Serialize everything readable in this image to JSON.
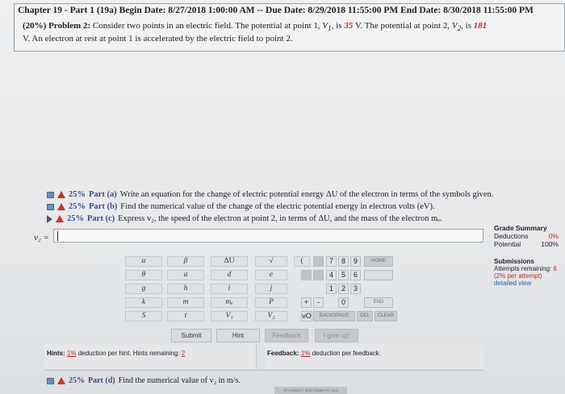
{
  "header": {
    "line": "Chapter 19 - Part 1 (19a) Begin Date: 8/27/2018 1:00:00 AM -- Due Date: 8/29/2018 11:55:00 PM End Date: 8/30/2018 11:55:00 PM"
  },
  "problem": {
    "prefix": "(20%) Problem 2:",
    "text_a": " Consider two points in an electric field. The potential at point 1, ",
    "v1_sym": "V",
    "v1_sub": "1",
    "text_b": ", is ",
    "v1_val": "35",
    "text_c": " V. The potential at point 2, ",
    "v2_sym": "V",
    "v2_sub": "2",
    "text_d": ", is ",
    "v2_val": "181",
    "line2": "V. An electron at rest at point 1 is accelerated by the electric field to point 2."
  },
  "parts": [
    {
      "pct": "25%",
      "label": "Part (a)",
      "text": "Write an equation for the change of electric potential energy ΔU of the electron in terms of the symbols given."
    },
    {
      "pct": "25%",
      "label": "Part (b)",
      "text": "Find the numerical value of the change of the electric potential energy in electron volts (eV)."
    },
    {
      "pct": "25%",
      "label": "Part (c)",
      "text": "Express v₂, the speed of the electron at point 2, in terms of ΔU, and the mass of the electron mₑ."
    },
    {
      "pct": "25%",
      "label": "Part (d)",
      "text": "Find the numerical value of v₂ in m/s."
    }
  ],
  "answer": {
    "label": "v₂ =",
    "value": ""
  },
  "grade_summary": {
    "title": "Grade Summary",
    "deductions_label": "Deductions",
    "deductions_val": "0%",
    "potential_label": "Potential",
    "potential_val": "100%"
  },
  "submissions": {
    "title": "Submissions",
    "attempts": "Attempts remaining: ",
    "attempts_val": "6",
    "per_attempt": "(2% per attempt)",
    "detailed": "detailed view"
  },
  "keypad": {
    "symbols": [
      [
        "α",
        "β",
        "ΔU",
        "√",
        "("
      ],
      [
        "θ",
        "a",
        "d",
        "e",
        ""
      ],
      [
        "g",
        "h",
        "i",
        "j",
        ""
      ],
      [
        "k",
        "m",
        "mₑ",
        "P",
        ""
      ],
      [
        "S",
        "t",
        "V₁",
        "V₂",
        ""
      ]
    ],
    "numbers": [
      [
        "7",
        "8",
        "9"
      ],
      [
        "4",
        "5",
        "6"
      ],
      [
        "1",
        "2",
        "3"
      ],
      [
        "+",
        "-",
        "0"
      ],
      [
        "vO",
        "",
        ""
      ]
    ],
    "home": "HOME",
    "end": "END",
    "backspace": "BACKSPACE",
    "del": "DEL",
    "clear": "CLEAR"
  },
  "buttons": {
    "submit": "Submit",
    "hint": "Hint",
    "feedback": "Feedback",
    "give_up": "I give up!"
  },
  "hints": {
    "label": "Hints:",
    "pct": "1%",
    "text": " deduction per hint. Hints remaining: ",
    "remaining": "2"
  },
  "feedback": {
    "label": "Feedback:",
    "pct": "1%",
    "text": " deduction per feedback."
  },
  "footer": "All content © 2018 Expert TA, LLC"
}
